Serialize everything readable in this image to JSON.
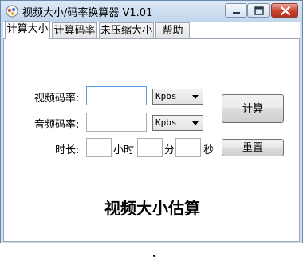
{
  "window": {
    "title": "视频大小/码率换算器 V1.01"
  },
  "tabs": [
    {
      "label": "计算大小",
      "active": true
    },
    {
      "label": "计算码率",
      "active": false
    },
    {
      "label": "未压缩大小",
      "active": false
    },
    {
      "label": "帮助",
      "active": false
    }
  ],
  "form": {
    "video_bitrate_label": "视频码率:",
    "video_bitrate_value": "",
    "video_bitrate_unit": "Kpbs",
    "audio_bitrate_label": "音频码率:",
    "audio_bitrate_value": "",
    "audio_bitrate_unit": "Kpbs",
    "duration_label": "时长:",
    "hours_value": "",
    "hours_unit": "小时",
    "minutes_value": "",
    "minutes_unit": "分",
    "seconds_value": "",
    "seconds_unit": "秒"
  },
  "buttons": {
    "calculate": "计算",
    "reset": "重置"
  },
  "heading": "视频大小估算",
  "colors": {
    "title_bar": "#c3d6ec",
    "close_button": "#c7432f",
    "focus_border": "#569de5"
  }
}
